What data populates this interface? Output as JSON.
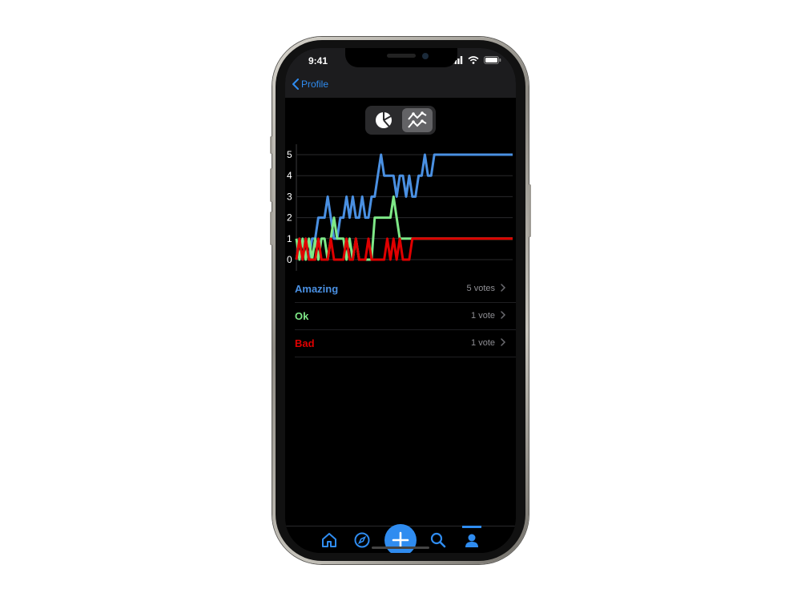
{
  "status_bar": {
    "time": "9:41"
  },
  "nav": {
    "back_label": "Profile"
  },
  "segmented": {
    "options": [
      "pie-chart-icon",
      "line-chart-icon"
    ],
    "selected": 1
  },
  "chart_data": {
    "type": "line",
    "y_ticks": [
      "5",
      "4",
      "3",
      "2",
      "1",
      "0"
    ],
    "ylim": [
      0,
      5
    ],
    "grid": true,
    "x": [
      0,
      1,
      2,
      3,
      4,
      5,
      6,
      7,
      8,
      9,
      10,
      11,
      12,
      13,
      14,
      15,
      16,
      17,
      18,
      19,
      20,
      21,
      22,
      23,
      24,
      25,
      26,
      27,
      28,
      29,
      30,
      31,
      32,
      33,
      34,
      35,
      36,
      37,
      38,
      39,
      40,
      41,
      42,
      43,
      44,
      45,
      46,
      47,
      48,
      49,
      50,
      51,
      52,
      53,
      54,
      55,
      56,
      57,
      58,
      59,
      60,
      61,
      62,
      63,
      64,
      65,
      66,
      67,
      68,
      69
    ],
    "series": [
      {
        "name": "Amazing",
        "color": "#4a90e2",
        "values": [
          0,
          1,
          0,
          1,
          0,
          1,
          1,
          2,
          2,
          2,
          3,
          2,
          1,
          1,
          2,
          2,
          3,
          2,
          3,
          2,
          2,
          3,
          2,
          2,
          3,
          3,
          4,
          5,
          4,
          4,
          4,
          4,
          3,
          4,
          4,
          3,
          4,
          3,
          3,
          4,
          4,
          5,
          4,
          4,
          5,
          5,
          5,
          5,
          5,
          5,
          5,
          5,
          5,
          5,
          5,
          5,
          5,
          5,
          5,
          5,
          5,
          5,
          5,
          5,
          5,
          5,
          5,
          5,
          5,
          5
        ]
      },
      {
        "name": "Ok",
        "color": "#7ee887",
        "values": [
          1,
          0,
          1,
          0,
          1,
          0,
          1,
          0,
          1,
          1,
          0,
          1,
          2,
          1,
          1,
          1,
          0,
          1,
          0,
          1,
          0,
          0,
          0,
          0,
          0,
          2,
          2,
          2,
          2,
          2,
          2,
          3,
          2,
          1,
          1,
          1,
          1,
          1,
          1,
          1,
          1,
          1,
          1,
          1,
          1,
          1,
          1,
          1,
          1,
          1,
          1,
          1,
          1,
          1,
          1,
          1,
          1,
          1,
          1,
          1,
          1,
          1,
          1,
          1,
          1,
          1,
          1,
          1,
          1,
          1
        ]
      },
      {
        "name": "Bad",
        "color": "#e00000",
        "values": [
          0,
          1,
          0,
          1,
          0,
          0,
          0,
          1,
          0,
          0,
          0,
          1,
          0,
          0,
          0,
          0,
          1,
          0,
          0,
          1,
          0,
          0,
          0,
          1,
          0,
          0,
          0,
          0,
          0,
          1,
          0,
          1,
          0,
          1,
          0,
          0,
          0,
          1,
          1,
          1,
          1,
          1,
          1,
          1,
          1,
          1,
          1,
          1,
          1,
          1,
          1,
          1,
          1,
          1,
          1,
          1,
          1,
          1,
          1,
          1,
          1,
          1,
          1,
          1,
          1,
          1,
          1,
          1,
          1,
          1
        ]
      }
    ]
  },
  "results": [
    {
      "label": "Amazing",
      "count": "5 votes",
      "color": "#4a90e2"
    },
    {
      "label": "Ok",
      "count": "1 vote",
      "color": "#7ee887"
    },
    {
      "label": "Bad",
      "count": "1 vote",
      "color": "#e00000"
    }
  ],
  "tabs": [
    {
      "icon": "home-icon"
    },
    {
      "icon": "compass-icon"
    },
    {
      "icon": "plus-icon"
    },
    {
      "icon": "search-icon"
    },
    {
      "icon": "profile-icon",
      "active": true
    }
  ]
}
